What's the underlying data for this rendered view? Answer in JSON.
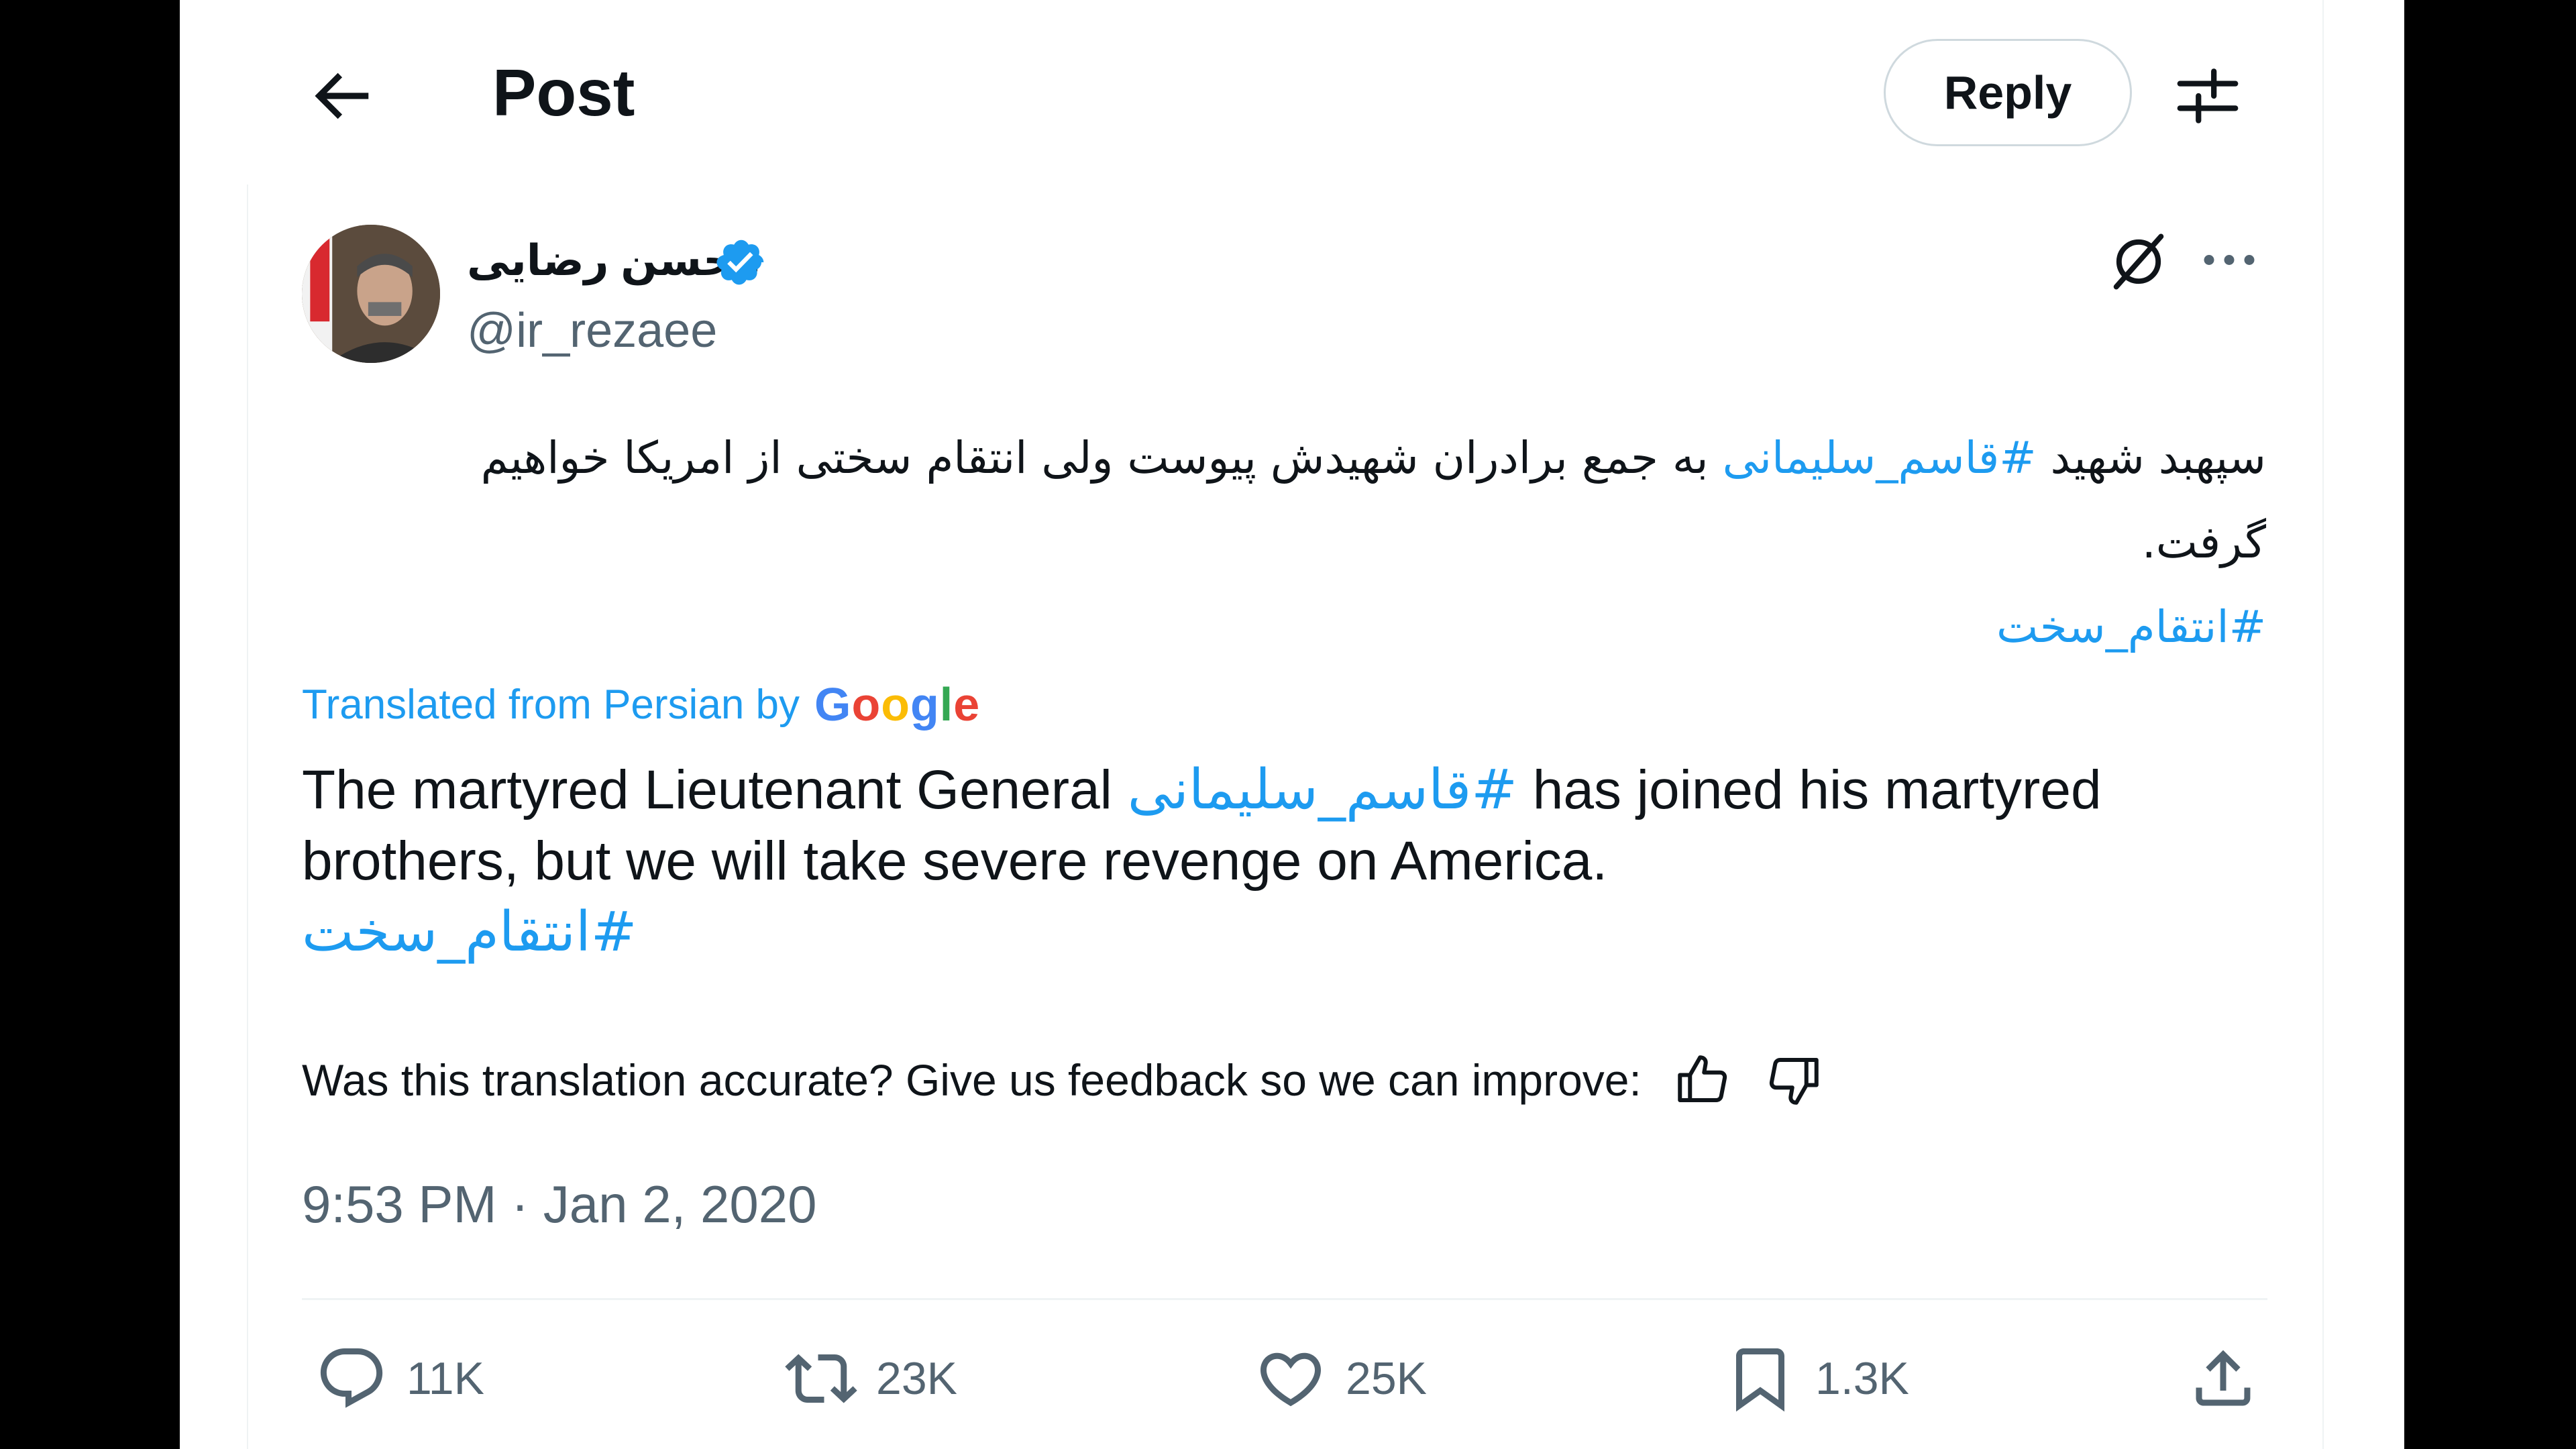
{
  "header": {
    "title": "Post",
    "reply_label": "Reply"
  },
  "author": {
    "name": "محسن رضایی",
    "handle": "@ir_rezaee",
    "verified": true
  },
  "tweet": {
    "persian_before": "سپهبد شهید ",
    "persian_hashtag1": "#قاسم_سلیمانی",
    "persian_after": " به جمع برادران شهیدش پیوست ولی انتقام سختی از امریکا خواهیم گرفت.",
    "persian_hashtag2": "#انتقام_سخت"
  },
  "translation": {
    "label": "Translated from Persian by",
    "provider": "Google",
    "text_before": "The martyred Lieutenant General ",
    "hashtag1": "#قاسم_سلیمانی",
    "text_after": " has joined his martyred brothers, but we will take severe revenge on America.",
    "hashtag2": "#انتقام_سخت",
    "feedback_prompt": "Was this translation accurate? Give us feedback so we can improve:"
  },
  "timestamp": "9:53 PM · Jan 2, 2020",
  "stats": {
    "replies": "11K",
    "reposts": "23K",
    "likes": "25K",
    "bookmarks": "1.3K"
  },
  "colors": {
    "accent": "#1d9bf0",
    "text": "#0f1419",
    "muted": "#536471"
  }
}
